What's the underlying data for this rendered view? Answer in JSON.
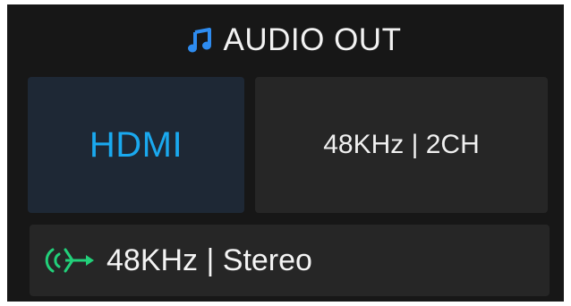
{
  "header": {
    "icon": "music-note-icon",
    "title": "AUDIO OUT"
  },
  "output": {
    "port": "HDMI",
    "format": "48KHz | 2CH"
  },
  "signal": {
    "icon": "audio-signal-icon",
    "label": "48KHz | Stereo"
  },
  "colors": {
    "accent": "#1aa9ef",
    "icon_blue": "#2e8cf0",
    "signal_green": "#22d07a",
    "panel_bg": "#171717",
    "tile_bg": "#262626",
    "selected_tile_bg": "#1e2835"
  }
}
